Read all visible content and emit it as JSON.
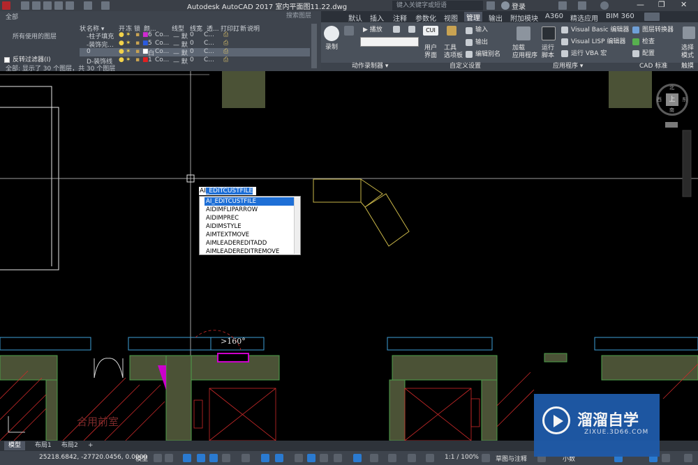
{
  "window": {
    "title": "Autodesk AutoCAD 2017    室内平面图11.22.dwg",
    "search_placeholder": "键入关键字或短语",
    "login": "登录"
  },
  "ribbon": {
    "tabs": [
      "默认",
      "插入",
      "注释",
      "参数化",
      "视图",
      "管理",
      "输出",
      "附加模块",
      "A360",
      "精选应用",
      "BIM 360"
    ],
    "active_tab": "管理",
    "record": "录制",
    "play": "播放",
    "user_interface": "用户\n界面",
    "tool_palettes": "工具\n选项板",
    "import": "输入",
    "export": "输出",
    "edit_aliases": "编辑别名",
    "cui": "CUI",
    "load_app": "加载\n应用程序",
    "run_script": "运行\n脚本",
    "vb_editor": "Visual Basic 编辑器",
    "lisp_editor": "Visual LISP 编辑器",
    "run_vba": "运行 VBA 宏",
    "layer_translator": "图层转换器",
    "check": "检查",
    "configure": "配置",
    "select_mode": "选择\n模式",
    "groups": [
      "动作录制器 ▾",
      "自定义设置",
      "应用程序 ▾",
      "CAD 标准",
      "触摸"
    ]
  },
  "layers": {
    "header": "名称 ▾",
    "search": "搜索图层",
    "filter_all": "全部",
    "unused": "所有使用的图层",
    "invert": "反转过滤器(I)",
    "status": "全部: 显示了 30 个图层，共 30 个图层",
    "columns": [
      "状",
      "名称",
      "开",
      "冻",
      "锁",
      "颜...",
      "线型",
      "线宽",
      "透...",
      "打印...",
      "打",
      "新",
      "说明"
    ],
    "rows": [
      {
        "name": "-柱子填充",
        "color": "6",
        "linetype": "Co...",
        "lw": "— 默",
        "tr": "0",
        "plot": "C..."
      },
      {
        "name": "-装饰完...",
        "color": "5",
        "linetype": "Co...",
        "lw": "— 默",
        "tr": "0",
        "plot": "C..."
      },
      {
        "name": "0",
        "color": "白",
        "linetype": "Co...",
        "lw": "— 默",
        "tr": "0",
        "plot": "C..."
      },
      {
        "name": "D-装饰线",
        "color": "1",
        "linetype": "Co...",
        "lw": "— 默",
        "tr": "0",
        "plot": "C..."
      }
    ]
  },
  "viewcube": {
    "north": "北",
    "south": "南",
    "west": "西",
    "east": "东",
    "top": "上"
  },
  "command": {
    "typed": "AI",
    "completion": "_EDITCUSTFILE",
    "suggestions": [
      "AI_EDITCUSTFILE",
      "AIDIMFLIPARROW",
      "AIDIMPREC",
      "AIDIMSTYLE",
      "AIMTEXTMOVE",
      "AIMLEADEREDITADD",
      "AIMLEADEREDITREMOVE"
    ]
  },
  "drawing": {
    "dim_text": ">160°",
    "room_label": "合用前室"
  },
  "layout_tabs": [
    "模型",
    "布局1",
    "布局2",
    "+"
  ],
  "status": {
    "coords": "25218.6842, -27720.0456, 0.0000",
    "model": "模型",
    "scale": "1:1 / 100%",
    "workspace": "草图与注释",
    "units": "小数"
  },
  "watermark": {
    "brand": "溜溜自学",
    "url": "ZIXUE.3D66.COM"
  },
  "colors": {
    "bg": "#000000",
    "ribbon": "#4a515b",
    "selection": "#1e6fd6",
    "wall_fill": "#4b5236",
    "magenta": "#cc00cc"
  }
}
